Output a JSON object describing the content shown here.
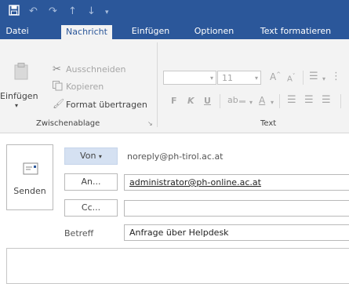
{
  "qat": {
    "icons": [
      "save-icon",
      "undo-icon",
      "redo-icon",
      "up-arrow-icon",
      "down-arrow-icon",
      "customize-dropdown-icon"
    ]
  },
  "tabs": [
    {
      "label": "Datei",
      "active": false
    },
    {
      "label": "Nachricht",
      "active": true
    },
    {
      "label": "Einfügen",
      "active": false
    },
    {
      "label": "Optionen",
      "active": false
    },
    {
      "label": "Text formatieren",
      "active": false
    }
  ],
  "clipboard": {
    "paste_label": "Einfügen",
    "cut_label": "Ausschneiden",
    "copy_label": "Kopieren",
    "format_painter_label": "Format übertragen",
    "group_label": "Zwischenablage"
  },
  "text_group": {
    "font_name": "",
    "font_size": "11",
    "bold": "F",
    "italic": "K",
    "underline": "U",
    "group_label": "Text"
  },
  "header": {
    "send_label": "Senden",
    "from_label": "Von",
    "from_value": "noreply@ph-tirol.ac.at",
    "to_label": "An...",
    "to_value": "administrator@ph-online.ac.at",
    "cc_label": "Cc...",
    "cc_value": "",
    "subject_label": "Betreff",
    "subject_value": "Anfrage über Helpdesk"
  },
  "colors": {
    "accent": "#2b579a",
    "ribbon_bg": "#f3f3f3",
    "from_button_bg": "#d5e1f2"
  }
}
